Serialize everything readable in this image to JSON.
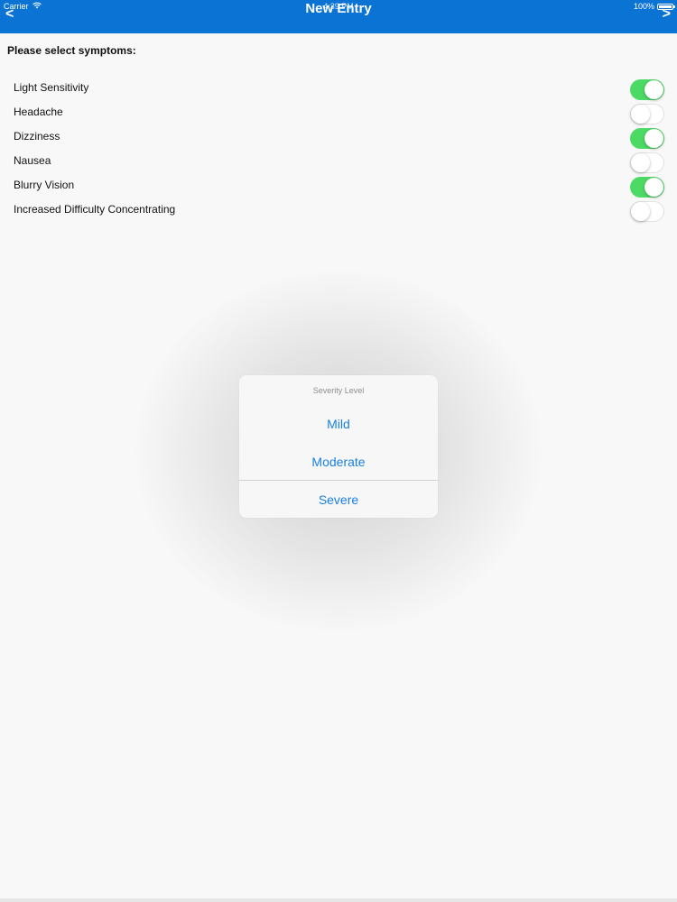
{
  "status_bar": {
    "carrier": "Carrier",
    "time": "4:39 PM",
    "battery": "100%"
  },
  "nav": {
    "title": "New Entry",
    "back_label": "<",
    "forward_label": ">",
    "accent_color": "#0a73d4"
  },
  "form": {
    "prompt": "Please select symptoms:",
    "symptoms": [
      {
        "label": "Light Sensitivity",
        "on": true
      },
      {
        "label": "Headache",
        "on": false
      },
      {
        "label": "Dizziness",
        "on": true
      },
      {
        "label": "Nausea",
        "on": false
      },
      {
        "label": "Blurry Vision",
        "on": true
      },
      {
        "label": "Increased Difficulty Concentrating",
        "on": false
      }
    ],
    "toggle_on_color": "#4cd964"
  },
  "dialog": {
    "title": "Severity Level",
    "options": [
      "Mild",
      "Moderate",
      "Severe"
    ],
    "option_color": "#1a7fe0"
  }
}
